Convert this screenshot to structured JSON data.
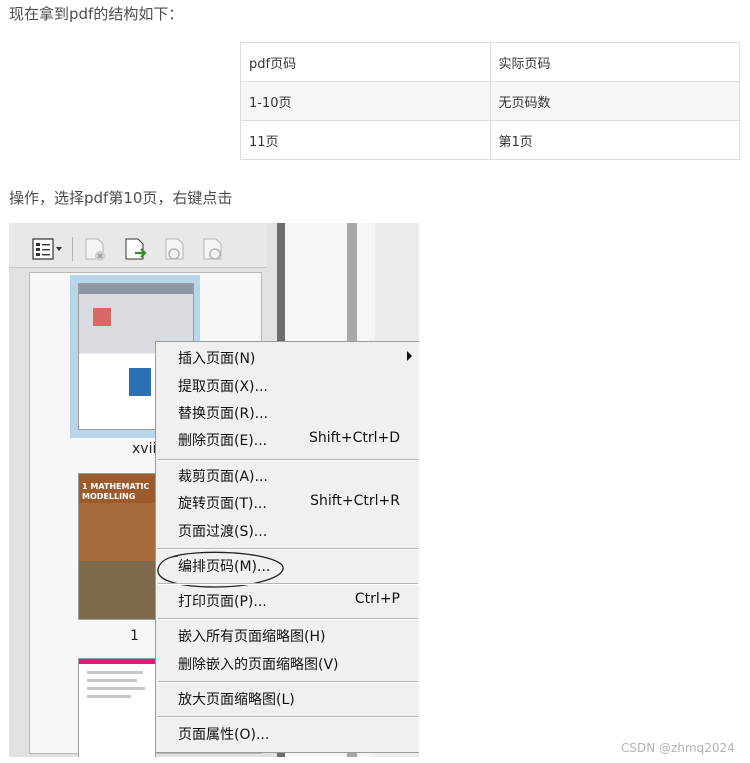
{
  "intro_text": "现在拿到pdf的结构如下：",
  "table": {
    "headers": [
      "pdf页码",
      "实际页码"
    ],
    "rows": [
      [
        "1-10页",
        "无页码数"
      ],
      [
        "11页",
        "第1页"
      ]
    ]
  },
  "step_text": "操作，选择pdf第10页，右键点击",
  "screenshot": {
    "toolbar_icons": [
      "thumbnail-options-icon",
      "delete-page-icon",
      "insert-page-icon",
      "rotate-page-left-icon",
      "rotate-page-right-icon"
    ],
    "thumbnail_labels": [
      "xvii",
      "1"
    ],
    "thumbnail_2_title": "1 MATHEMATIC\nMODELLING",
    "context_menu": {
      "insert_page": "插入页面(N)",
      "extract_page": "提取页面(X)...",
      "replace_page": "替换页面(R)...",
      "delete_page": "删除页面(E)...",
      "delete_page_shortcut": "Shift+Ctrl+D",
      "crop_page": "裁剪页面(A)...",
      "rotate_page": "旋转页面(T)...",
      "rotate_page_shortcut": "Shift+Ctrl+R",
      "page_transition": "页面过渡(S)...",
      "number_pages": "编排页码(M)...",
      "print_page": "打印页面(P)...",
      "print_page_shortcut": "Ctrl+P",
      "embed_thumbnails": "嵌入所有页面缩略图(H)",
      "remove_embedded_thumbnails": "删除嵌入的页面缩略图(V)",
      "enlarge_thumbnails": "放大页面缩略图(L)",
      "page_properties": "页面属性(O)..."
    }
  },
  "watermark": "CSDN @zhmq2024"
}
